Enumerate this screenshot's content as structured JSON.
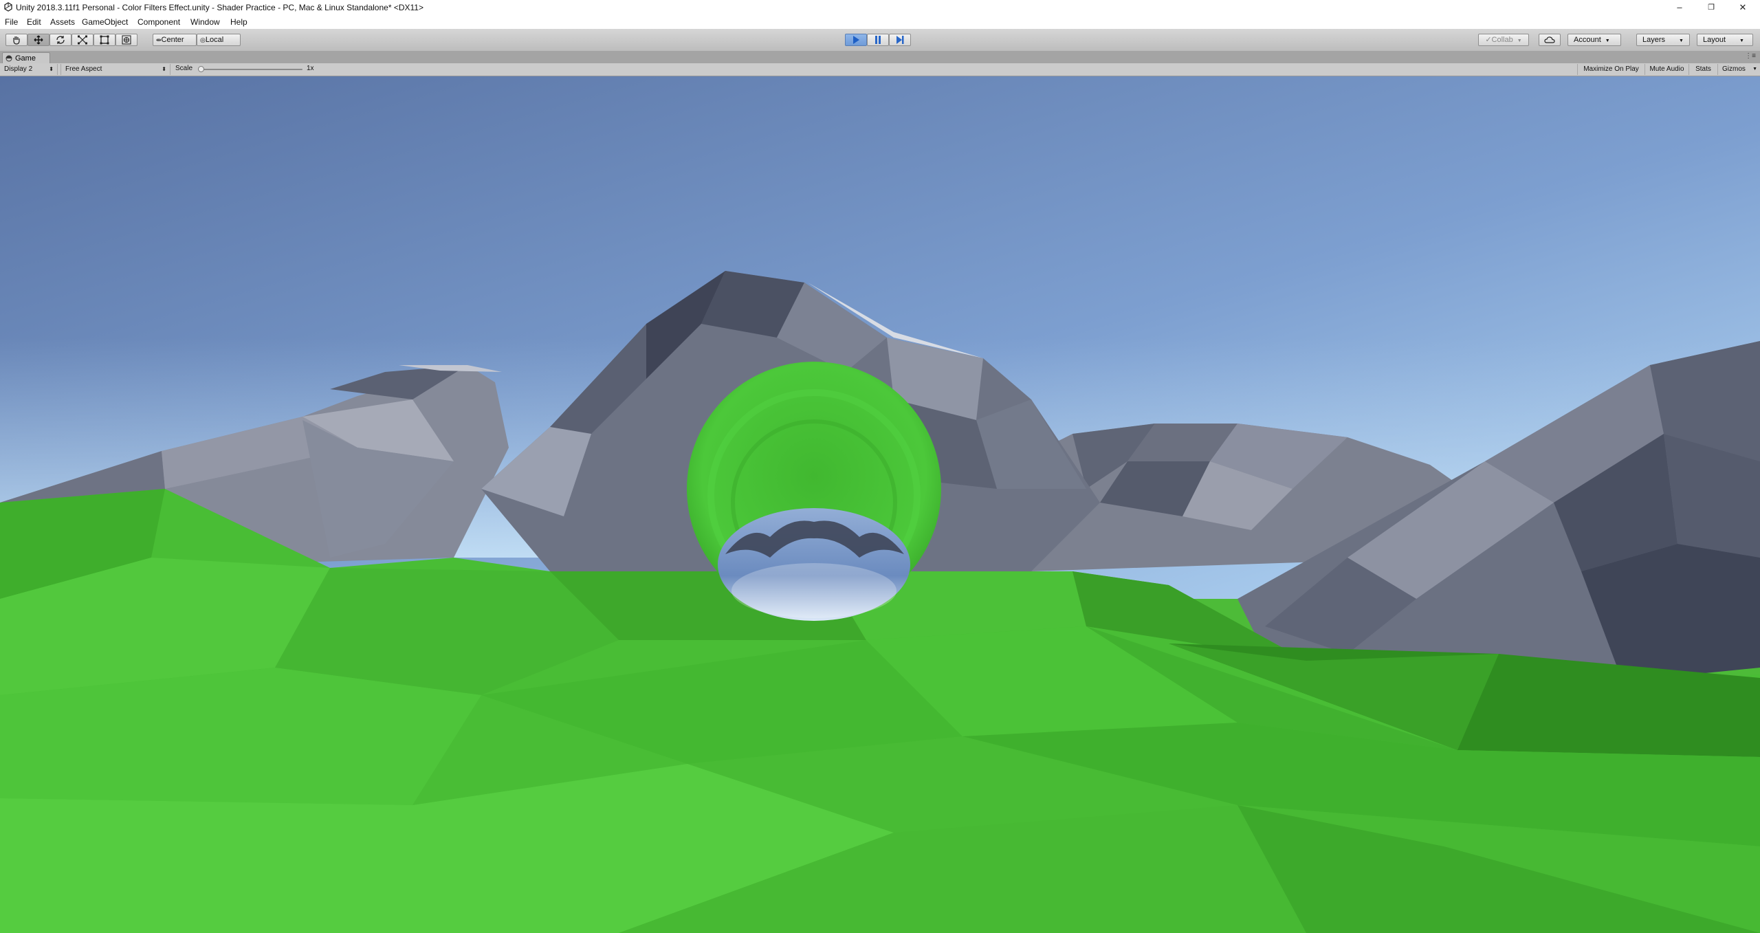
{
  "window": {
    "title": "Unity 2018.3.11f1 Personal - Color Filters Effect.unity - Shader Practice - PC, Mac & Linux Standalone* <DX11>",
    "controls": [
      "–",
      "❐",
      "✕"
    ]
  },
  "menu": [
    "File",
    "Edit",
    "Assets",
    "GameObject",
    "Component",
    "Window",
    "Help"
  ],
  "toolbar": {
    "tools": [
      "hand-tool",
      "move-tool",
      "rotate-tool",
      "scale-tool",
      "rect-tool",
      "transform-tool"
    ],
    "active_tool": "move-tool",
    "pivot_mode": "Center",
    "pivot_rotation": "Local",
    "play_state": "playing",
    "collab": "Collab",
    "account": "Account",
    "layers": "Layers",
    "layout": "Layout"
  },
  "game_tab": {
    "label": "Game"
  },
  "game_view": {
    "display": "Display 2",
    "aspect": "Free Aspect",
    "scale_label": "Scale",
    "scale_value": "1x",
    "scale_fraction": 0,
    "maximize_on_play": "Maximize On Play",
    "mute_audio": "Mute Audio",
    "stats": "Stats",
    "gizmos": "Gizmos"
  },
  "colors": {
    "sky_top": "#5b78a8",
    "sky_bottom": "#b3d4f2",
    "grass": "#49bd35",
    "mountain": "#6f7585",
    "orb_green": "#46c535",
    "play_active": "#6f9bd8"
  }
}
